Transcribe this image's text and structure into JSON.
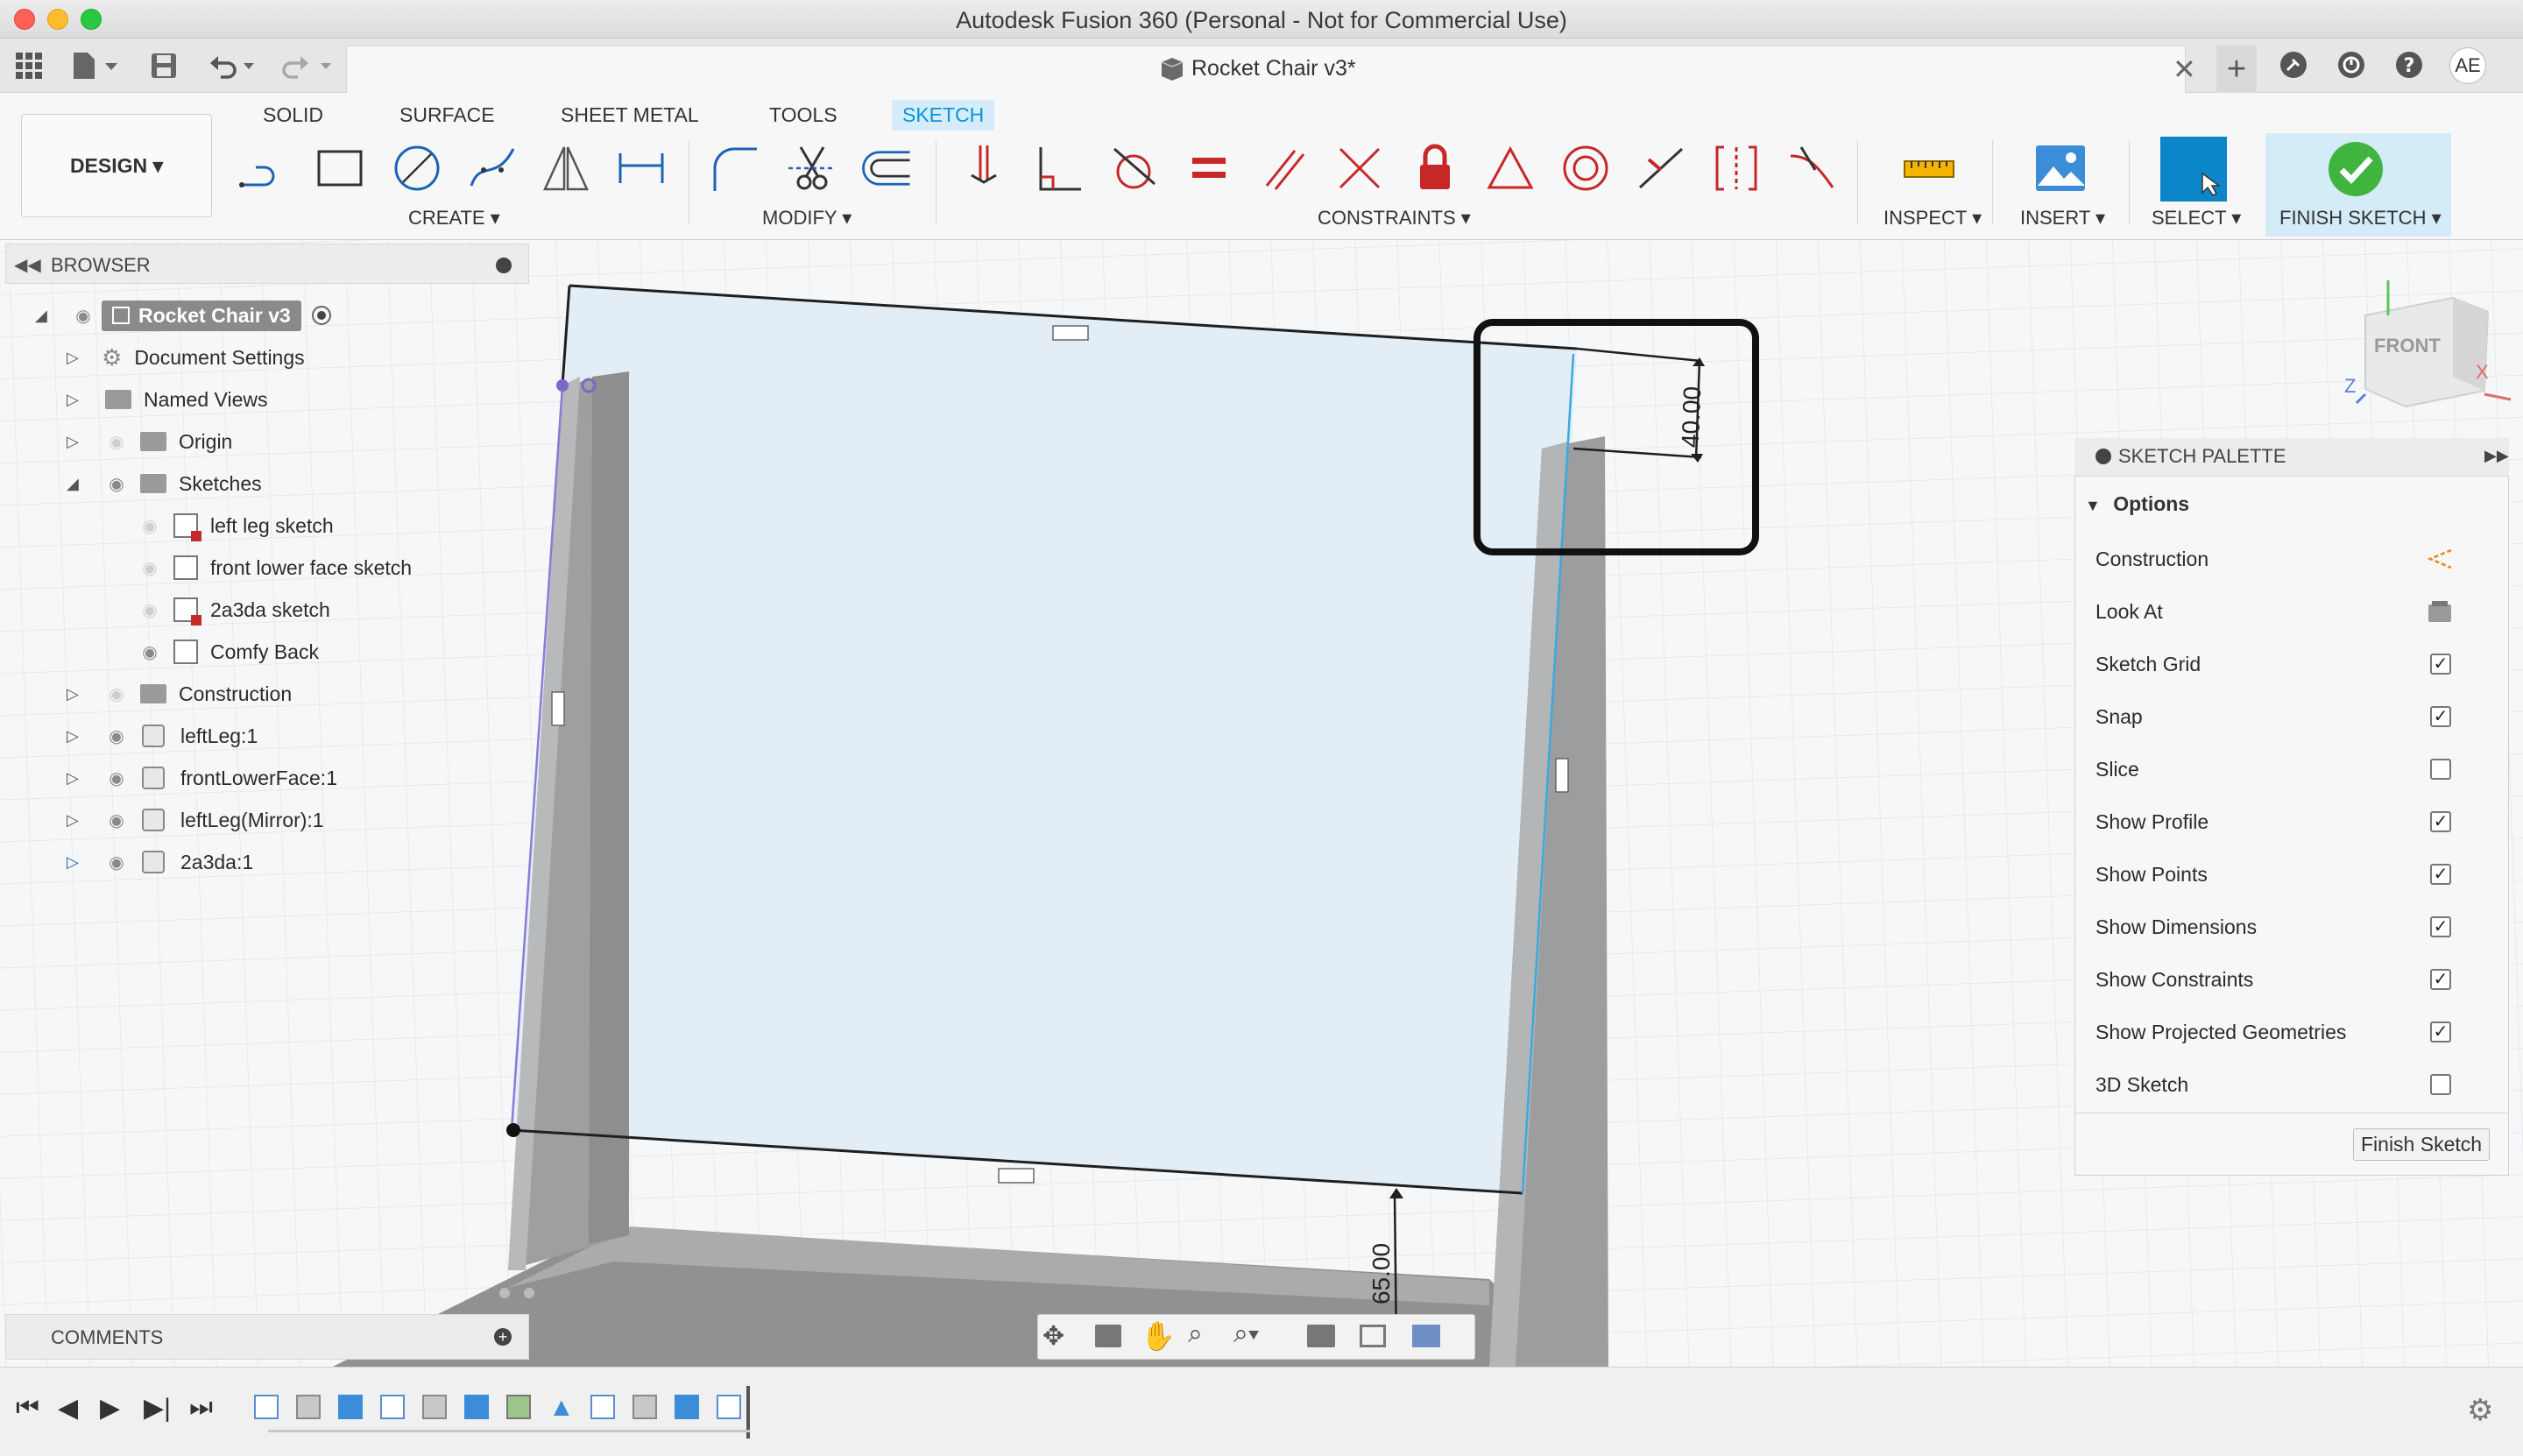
{
  "window": {
    "title": "Autodesk Fusion 360 (Personal - Not for Commercial Use)"
  },
  "document": {
    "tab_title": "Rocket Chair v3*",
    "user_initials": "AE"
  },
  "workspace": {
    "design_label": "DESIGN ▾"
  },
  "tabs": [
    "SOLID",
    "SURFACE",
    "SHEET METAL",
    "TOOLS",
    "SKETCH"
  ],
  "active_tab": "SKETCH",
  "groups": {
    "create": "CREATE ▾",
    "modify": "MODIFY ▾",
    "constraints": "CONSTRAINTS ▾",
    "inspect": "INSPECT ▾",
    "insert": "INSERT ▾",
    "select": "SELECT ▾",
    "finish": "FINISH SKETCH ▾"
  },
  "browser": {
    "title": "BROWSER",
    "root": "Rocket Chair v3",
    "items": [
      {
        "label": "Document Settings",
        "type": "settings"
      },
      {
        "label": "Named Views",
        "type": "folder"
      },
      {
        "label": "Origin",
        "type": "folder"
      },
      {
        "label": "Sketches",
        "type": "folder"
      },
      {
        "label": "left leg sketch",
        "type": "sketch-locked"
      },
      {
        "label": "front lower face sketch",
        "type": "sketch"
      },
      {
        "label": "2a3da sketch",
        "type": "sketch-locked"
      },
      {
        "label": "Comfy Back",
        "type": "sketch"
      },
      {
        "label": "Construction",
        "type": "folder"
      },
      {
        "label": "leftLeg:1",
        "type": "component"
      },
      {
        "label": "frontLowerFace:1",
        "type": "component"
      },
      {
        "label": "leftLeg(Mirror):1",
        "type": "component"
      },
      {
        "label": "2a3da:1",
        "type": "component"
      }
    ]
  },
  "viewcube": {
    "face": "FRONT",
    "x_axis": "X",
    "z_axis": "Z"
  },
  "dimensions": {
    "top": "40.00",
    "bottom": "65.00"
  },
  "palette": {
    "title": "SKETCH PALETTE",
    "section": "Options",
    "options": [
      {
        "label": "Construction",
        "kind": "icon",
        "icon": "construction-icon"
      },
      {
        "label": "Look At",
        "kind": "icon",
        "icon": "look-at-icon"
      },
      {
        "label": "Sketch Grid",
        "kind": "check",
        "checked": true
      },
      {
        "label": "Snap",
        "kind": "check",
        "checked": true
      },
      {
        "label": "Slice",
        "kind": "check",
        "checked": false
      },
      {
        "label": "Show Profile",
        "kind": "check",
        "checked": true
      },
      {
        "label": "Show Points",
        "kind": "check",
        "checked": true
      },
      {
        "label": "Show Dimensions",
        "kind": "check",
        "checked": true
      },
      {
        "label": "Show Constraints",
        "kind": "check",
        "checked": true
      },
      {
        "label": "Show Projected Geometries",
        "kind": "check",
        "checked": true
      },
      {
        "label": "3D Sketch",
        "kind": "check",
        "checked": false
      }
    ],
    "finish_button": "Finish Sketch"
  },
  "comments": {
    "title": "COMMENTS"
  }
}
